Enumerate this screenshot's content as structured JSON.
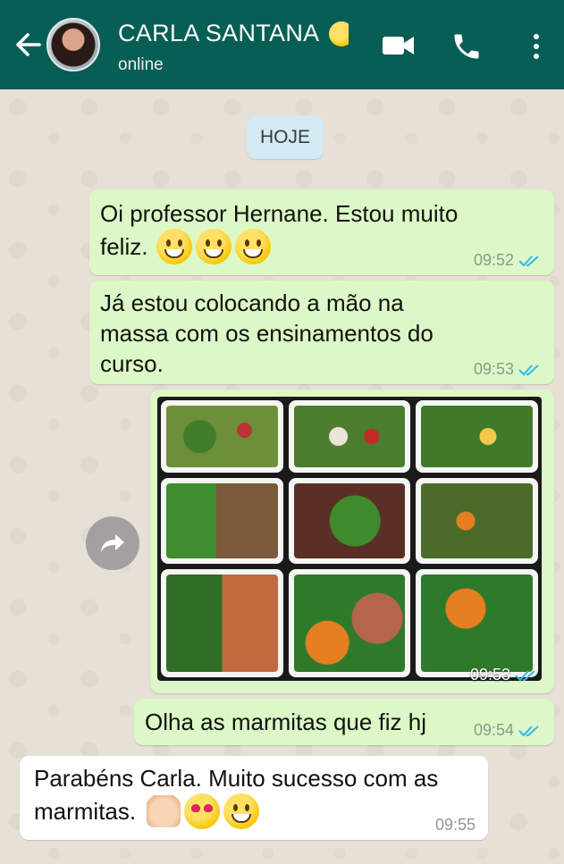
{
  "header": {
    "contact_name": "CARLA SANTANA",
    "status": "online",
    "icons": [
      "back-arrow-icon",
      "video-call-icon",
      "voice-call-icon",
      "more-options-icon"
    ],
    "color": "#075e54"
  },
  "date_separator": "HOJE",
  "messages": [
    {
      "direction": "out",
      "text_line1": "Oi professor Hernane. Estou muito",
      "text_line2": "feliz.",
      "emojis": [
        "grinning-face",
        "grinning-face",
        "grinning-face"
      ],
      "time": "09:52",
      "status": "read"
    },
    {
      "direction": "out",
      "text_line1": "Já estou colocando a mão na",
      "text_line2": "massa com os ensinamentos do",
      "text_line3": "curso.",
      "time": "09:53",
      "status": "read"
    },
    {
      "direction": "out",
      "type": "image",
      "time": "09:53",
      "status": "read"
    },
    {
      "direction": "out",
      "text": "Olha as marmitas que fiz hj",
      "time": "09:54",
      "status": "read"
    },
    {
      "direction": "in",
      "text_line1": "Parabéns Carla. Muito sucesso com as",
      "text_line2": "marmitas.",
      "emojis": [
        "clapping-hands",
        "heart-eyes-face",
        "grinning-face"
      ],
      "time": "09:55"
    }
  ],
  "colors": {
    "outgoing_bubble": "#dcf8c6",
    "incoming_bubble": "#ffffff",
    "read_ticks": "#34b7f1",
    "date_chip": "#d4eaf4"
  }
}
